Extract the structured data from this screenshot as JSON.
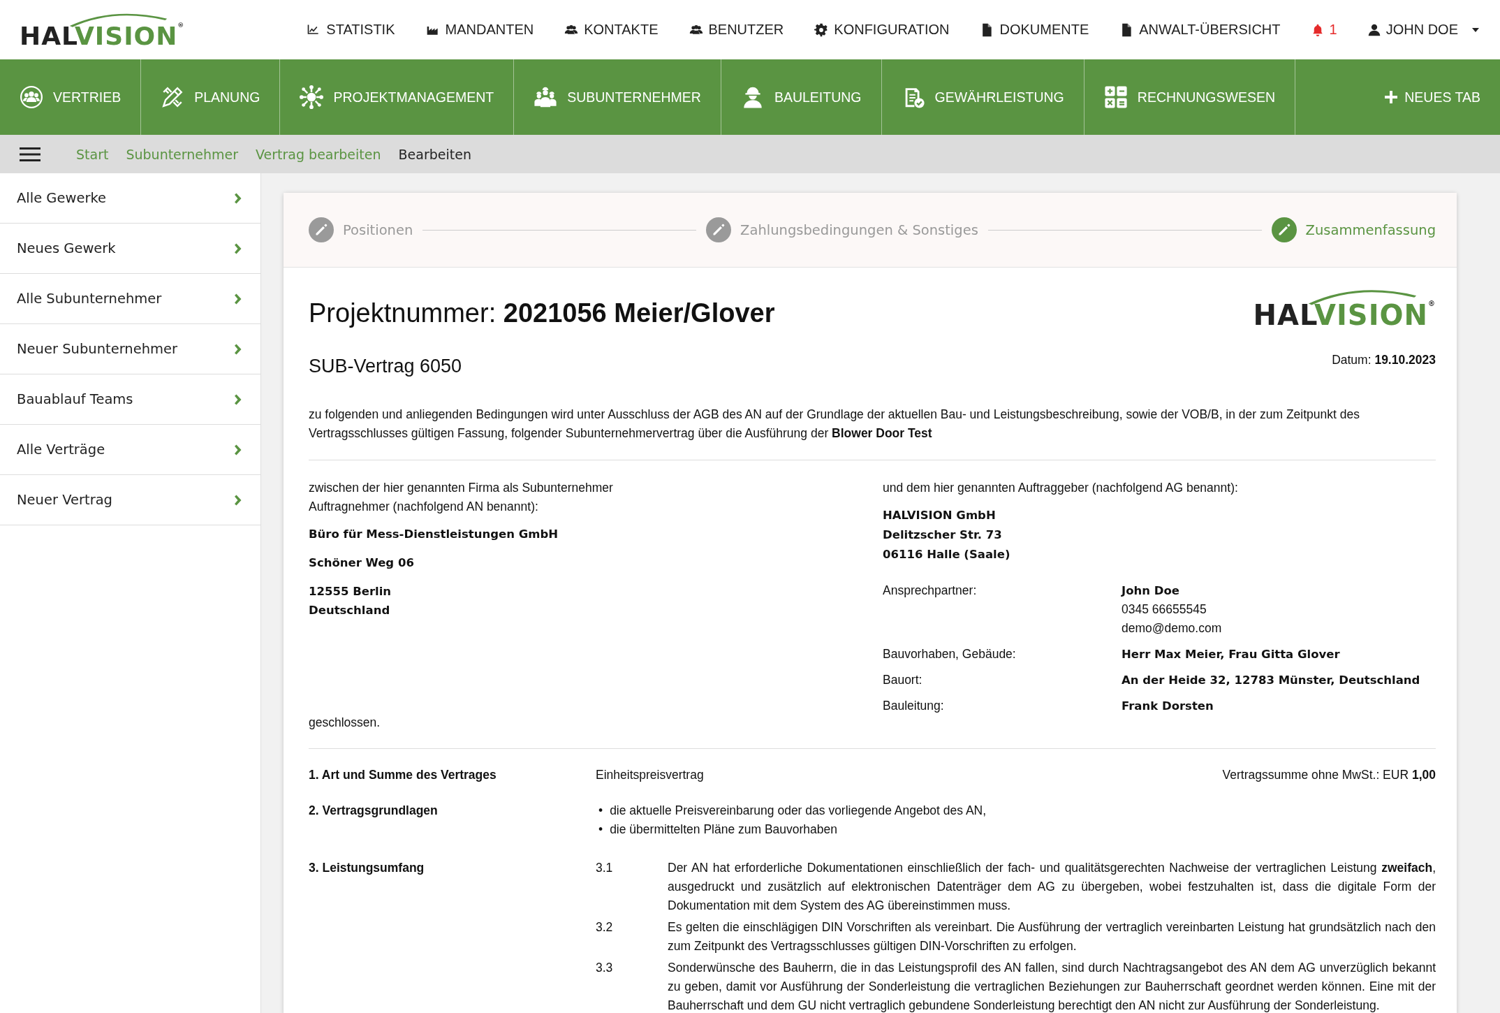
{
  "header": {
    "logo": {
      "dark": "HAL",
      "green": "VISION",
      "mark": "®"
    },
    "menu": [
      {
        "label": "STATISTIK"
      },
      {
        "label": "MANDANTEN"
      },
      {
        "label": "KONTAKTE"
      },
      {
        "label": "BENUTZER"
      },
      {
        "label": "KONFIGURATION"
      },
      {
        "label": "DOKUMENTE"
      },
      {
        "label": "ANWALT-ÜBERSICHT"
      }
    ],
    "notifications": "1",
    "user": "JOHN DOE"
  },
  "modules": {
    "items": [
      {
        "label": "VERTRIEB"
      },
      {
        "label": "PLANUNG"
      },
      {
        "label": "PROJEKTMANAGEMENT"
      },
      {
        "label": "SUBUNTERNEHMER"
      },
      {
        "label": "BAULEITUNG"
      },
      {
        "label": "GEWÄHRLEISTUNG"
      },
      {
        "label": "RECHNUNGSWESEN"
      }
    ],
    "new_tab": "NEUES TAB"
  },
  "breadcrumb": [
    {
      "label": "Start",
      "selected": false
    },
    {
      "label": "Subunternehmer",
      "selected": false
    },
    {
      "label": "Vertrag bearbeiten",
      "selected": false
    },
    {
      "label": "Bearbeiten",
      "selected": true
    }
  ],
  "sidebar": {
    "items": [
      {
        "label": "Alle Gewerke"
      },
      {
        "label": "Neues Gewerk"
      },
      {
        "label": "Alle Subunternehmer"
      },
      {
        "label": "Neuer Subunternehmer"
      },
      {
        "label": "Bauablauf Teams"
      },
      {
        "label": "Alle Verträge"
      },
      {
        "label": "Neuer Vertrag"
      }
    ]
  },
  "stepper": [
    {
      "label": "Positionen",
      "selected": false
    },
    {
      "label": "Zahlungsbedingungen & Sonstiges",
      "selected": false
    },
    {
      "label": "Zusammenfassung",
      "selected": true
    }
  ],
  "document": {
    "title_label": "Projektnummer:",
    "title_value": "2021056 Meier/Glover",
    "logo": {
      "dark": "HAL",
      "green": "VISION",
      "mark": "®"
    },
    "subtitle": "SUB-Vertrag 6050",
    "date": "Datum: **19.10.2023**",
    "intro": "zu folgenden und anliegenden Bedingungen wird unter Ausschluss der AGB des AN auf der Grundlage der aktuellen Bau- und Leistungsbeschreibung, sowie der VOB/B, in der zum Zeitpunkt des Vertragsschlusses gültigen Fassung, folgender Subunternehmervertrag über die Ausführung der **Blower Door Test**",
    "contractor": {
      "intro": "zwischen der hier genannten Firma als Subunternehmer Auftragnehmer (nachfolgend AN benannt):",
      "name": "Büro für Mess-Dienstleistungen GmbH",
      "street": "Schöner Weg 06",
      "city": "12555 Berlin",
      "country": "Deutschland"
    },
    "client": {
      "intro": "und dem hier genannten Auftraggeber (nachfolgend AG benannt):",
      "lines": [
        "HALVISION GmbH",
        "Delitzscher Str. 73",
        "06116 Halle (Saale)"
      ],
      "details": [
        {
          "label": "Ansprechpartner:",
          "values": [
            {
              "text": "John Doe",
              "emphasis": true
            },
            {
              "text": "0345 66655545",
              "emphasis": false
            },
            {
              "text": "demo@demo.com",
              "emphasis": false
            }
          ]
        },
        {
          "label": "Bauvorhaben, Gebäude:",
          "values": [
            {
              "text": "Herr Max Meier, Frau Gitta Glover",
              "emphasis": true
            }
          ]
        },
        {
          "label": "Bauort:",
          "values": [
            {
              "text": "An der Heide 32, 12783 Münster, Deutschland",
              "emphasis": true
            }
          ]
        },
        {
          "label": "Bauleitung:",
          "values": [
            {
              "text": "Frank Dorsten",
              "emphasis": true
            }
          ]
        }
      ]
    },
    "closing": "geschlossen.",
    "sections": [
      {
        "kind": "summary",
        "title": "1. Art und Summe des Vertrages",
        "text": "Einheitspreisvertrag",
        "sum": "Vertragssumme ohne MwSt.: EUR **1,00**"
      },
      {
        "kind": "list",
        "title": "2. Vertragsgrundlagen",
        "items": [
          {
            "marker": "•",
            "text": "die aktuelle Preisvereinbarung oder das vorliegende Angebot des AN,"
          },
          {
            "marker": "•",
            "text": "die übermittelten Pläne zum Bauvorhaben"
          }
        ]
      },
      {
        "kind": "clauses",
        "title": "3. Leistungsumfang",
        "clauses": [
          {
            "number": "3.1",
            "text": "Der AN hat erforderliche Dokumentationen einschließlich der fach- und qualitätsgerechten Nachweise der vertraglichen Leistung **zweifach**, ausgedruckt und zusätzlich auf elektronischen Datenträger dem AG zu übergeben, wobei festzuhalten ist, dass die digitale Form der Dokumentation mit dem System des AG übereinstimmen muss."
          },
          {
            "number": "3.2",
            "text": "Es gelten die einschlägigen DIN Vorschriften als vereinbart. Die Ausführung der vertraglich vereinbarten Leistung hat grundsätzlich nach den zum Zeitpunkt des Vertragsschlusses gültigen DIN-Vorschriften zu erfolgen."
          },
          {
            "number": "3.3",
            "text": "Sonderwünsche des Bauherrn, die in das Leistungsprofil des AN fallen, sind durch Nachtragsangebot des AN dem AG unverzüglich bekannt zu geben, damit vor Ausführung der Sonderleistung die vertraglichen Beziehungen zur Bauherrschaft geordnet werden können. Eine mit der Bauherrschaft und dem GU nicht vertraglich gebundene Sonderleistung berechtigt den AN nicht zur Ausführung der Sonderleistung."
          }
        ]
      }
    ]
  }
}
